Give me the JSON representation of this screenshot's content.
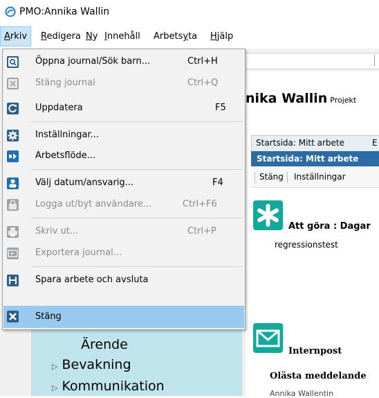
{
  "window": {
    "title": "PMO:Annika Wallin"
  },
  "menubar": {
    "items": [
      "Arkiv",
      "Redigera",
      "Ny",
      "Innehåll",
      "Arbetsyta",
      "Hjälp"
    ]
  },
  "arkiv_menu": {
    "items": [
      {
        "label": "Öppna journal/Sök barn...",
        "shortcut": "Ctrl+H"
      },
      {
        "label": "Stäng journal",
        "shortcut": "Ctrl+Q"
      },
      {
        "label": "Uppdatera",
        "shortcut": "F5"
      },
      {
        "label": "Inställningar...",
        "shortcut": ""
      },
      {
        "label": "Arbetsflöde...",
        "shortcut": ""
      },
      {
        "label": "Välj datum/ansvarig...",
        "shortcut": "F4"
      },
      {
        "label": "Logga ut/byt användare...",
        "shortcut": "Ctrl+F6"
      },
      {
        "label": "Skriv ut...",
        "shortcut": "Ctrl+P"
      },
      {
        "label": "Exportera journal...",
        "shortcut": ""
      },
      {
        "label": "Spara arbete och avsluta",
        "shortcut": ""
      },
      {
        "label": "Stäng",
        "shortcut": ""
      }
    ]
  },
  "tree": {
    "nodes": [
      "Ärende",
      "Bevakning",
      "Kommunikation"
    ]
  },
  "main": {
    "heading": "nika Wallin",
    "heading_sub": "Projekt",
    "tab1": "Startsida: Mitt arbete",
    "tab2": "E",
    "subheader": "Startsida: Mitt arbete",
    "actions": [
      "Stäng",
      "Inställningar"
    ],
    "todo_title": "Att göra : Dagar",
    "todo_sub": "regressionstest",
    "mail_title": "Internpost",
    "unread_label": "Olästa meddelande",
    "sender": "Annika Wallentin"
  },
  "colors": {
    "accent": "#2d6ba5",
    "tree_bg": "#bfe4eb",
    "highlight": "#99c9ef",
    "tile": "#14a89a"
  }
}
